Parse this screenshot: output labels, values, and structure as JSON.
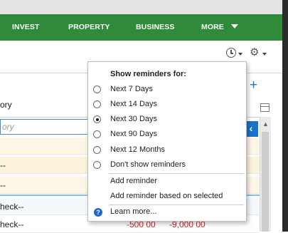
{
  "nav": {
    "items": [
      {
        "label": "INVEST"
      },
      {
        "label": "PROPERTY"
      },
      {
        "label": "BUSINESS"
      },
      {
        "label": "MORE"
      }
    ]
  },
  "table": {
    "column_header": "ory",
    "filter_placeholder": "ory",
    "rows": [
      {
        "text": ""
      },
      {
        "text": "--"
      },
      {
        "text": "--"
      },
      {
        "text": "heck--"
      },
      {
        "text": "heck--",
        "amount1": "-500 00",
        "amount2": "-9,000 00"
      }
    ]
  },
  "reminders": {
    "title": "Show reminders for:",
    "options": [
      {
        "label": "Next 7 Days",
        "selected": false
      },
      {
        "label": "Next 14 Days",
        "selected": false
      },
      {
        "label": "Next 30 Days",
        "selected": true
      },
      {
        "label": "Next 90 Days",
        "selected": false
      },
      {
        "label": "Next 12 Months",
        "selected": false
      },
      {
        "label": "Don't show reminders",
        "selected": false
      }
    ],
    "actions": [
      {
        "label": "Add reminder"
      },
      {
        "label": "Add reminder based on selected"
      }
    ],
    "help_label": "Learn more..."
  },
  "colors": {
    "nav_green": "#2f8a3a",
    "accent_blue": "#1b73c9",
    "negative_red": "#d2262a"
  }
}
